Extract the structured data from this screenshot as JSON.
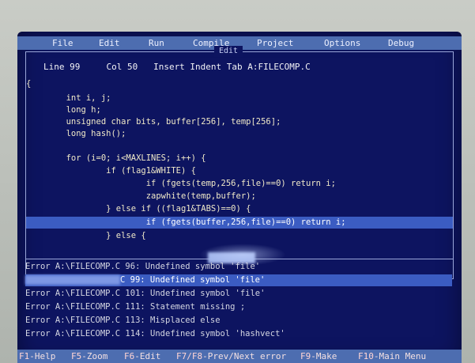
{
  "menu": [
    "File",
    "Edit",
    "Run",
    "Compile",
    "Project",
    "Options",
    "Debug"
  ],
  "edit_window": {
    "title": "Edit",
    "status": "Line 99     Col 50   Insert Indent Tab A:FILECOMP.C"
  },
  "code": [
    "{",
    "        int i, j;",
    "        long h;",
    "        unsigned char bits, buffer[256], temp[256];",
    "        long hash();",
    "",
    "        for (i=0; i<MAXLINES; i++) {",
    "                if (flag1&WHITE) {",
    "                        if (fgets(temp,256,file)==0) return i;",
    "                        zapwhite(temp,buffer);",
    "                } else if ((flag1&TABS)==0) {",
    "                        if (fgets(buffer,256,file)==0) return i;",
    "                } else {"
  ],
  "highlighted_code_line": 11,
  "messages": [
    "Error A:\\FILECOMP.C 96: Undefined symbol 'file'",
    "C 99: Undefined symbol 'file'",
    "Error A:\\FILECOMP.C 101: Undefined symbol 'file'",
    "Error A:\\FILECOMP.C 111: Statement missing ;",
    "Error A:\\FILECOMP.C 113: Misplaced else",
    "Error A:\\FILECOMP.C 114: Undefined symbol 'hashvect'"
  ],
  "highlighted_message": 1,
  "keybar": [
    {
      "key": "F1",
      "label": "-Help"
    },
    {
      "key": "F5",
      "label": "-Zoom"
    },
    {
      "key": "F6",
      "label": "-Edit"
    },
    {
      "key": "F7/F8",
      "label": "-Prev/Next error"
    },
    {
      "key": "F9",
      "label": "-Make"
    },
    {
      "key": "F10",
      "label": "-Main Menu"
    }
  ],
  "colors": {
    "screen_bg": "#0d1460",
    "bar_bg": "#4d6db0",
    "highlight": "#3b5cc2"
  }
}
